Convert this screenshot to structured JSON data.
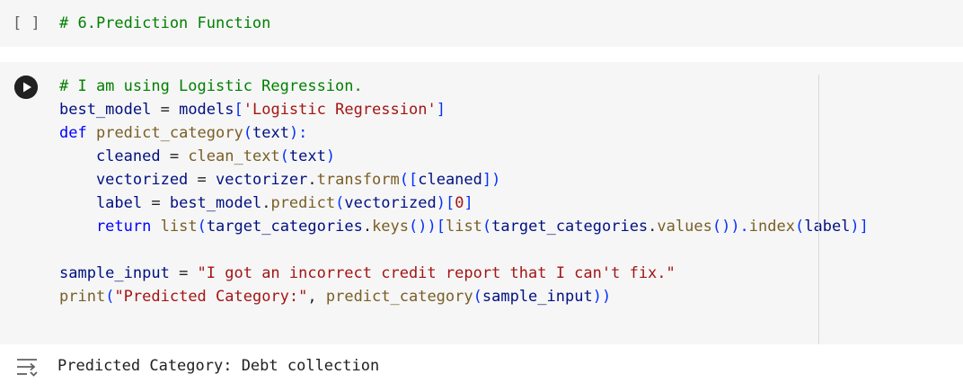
{
  "cells": [
    {
      "bracket": "[ ]",
      "lines": [
        [
          {
            "t": "# 6.Prediction Function",
            "c": "c"
          }
        ]
      ]
    },
    {
      "run_icon": "play-circle-icon",
      "lines": [
        [
          {
            "t": "# I am using Logistic Regression.",
            "c": "c"
          }
        ],
        [
          {
            "t": "best_model",
            "c": "v"
          },
          {
            "t": " = ",
            "c": ""
          },
          {
            "t": "models",
            "c": "v"
          },
          {
            "t": "[",
            "c": "b"
          },
          {
            "t": "'Logistic Regression'",
            "c": "s"
          },
          {
            "t": "]",
            "c": "b"
          }
        ],
        [
          {
            "t": "def",
            "c": "k"
          },
          {
            "t": " ",
            "c": ""
          },
          {
            "t": "predict_category",
            "c": "f"
          },
          {
            "t": "(",
            "c": "b"
          },
          {
            "t": "text",
            "c": "v"
          },
          {
            "t": "):",
            "c": "b"
          }
        ],
        [
          {
            "t": "    cleaned",
            "c": "v"
          },
          {
            "t": " = ",
            "c": ""
          },
          {
            "t": "clean_text",
            "c": "f"
          },
          {
            "t": "(",
            "c": "b"
          },
          {
            "t": "text",
            "c": "v"
          },
          {
            "t": ")",
            "c": "b"
          }
        ],
        [
          {
            "t": "    vectorized",
            "c": "v"
          },
          {
            "t": " = ",
            "c": ""
          },
          {
            "t": "vectorizer",
            "c": "v"
          },
          {
            "t": ".",
            "c": ""
          },
          {
            "t": "transform",
            "c": "f"
          },
          {
            "t": "([",
            "c": "b"
          },
          {
            "t": "cleaned",
            "c": "v"
          },
          {
            "t": "])",
            "c": "b"
          }
        ],
        [
          {
            "t": "    label",
            "c": "v"
          },
          {
            "t": " = ",
            "c": ""
          },
          {
            "t": "best_model",
            "c": "v"
          },
          {
            "t": ".",
            "c": ""
          },
          {
            "t": "predict",
            "c": "f"
          },
          {
            "t": "(",
            "c": "b"
          },
          {
            "t": "vectorized",
            "c": "v"
          },
          {
            "t": ")[",
            "c": "b"
          },
          {
            "t": "0",
            "c": "s"
          },
          {
            "t": "]",
            "c": "b"
          }
        ],
        [
          {
            "t": "    return",
            "c": "k"
          },
          {
            "t": " ",
            "c": ""
          },
          {
            "t": "list",
            "c": "f"
          },
          {
            "t": "(",
            "c": "b"
          },
          {
            "t": "target_categories",
            "c": "v"
          },
          {
            "t": ".",
            "c": ""
          },
          {
            "t": "keys",
            "c": "f"
          },
          {
            "t": "())[",
            "c": "b"
          },
          {
            "t": "list",
            "c": "f"
          },
          {
            "t": "(",
            "c": "b"
          },
          {
            "t": "target_categories",
            "c": "v"
          },
          {
            "t": ".",
            "c": ""
          },
          {
            "t": "values",
            "c": "f"
          },
          {
            "t": "()).",
            "c": "b"
          },
          {
            "t": "index",
            "c": "f"
          },
          {
            "t": "(",
            "c": "b"
          },
          {
            "t": "label",
            "c": "v"
          },
          {
            "t": ")]",
            "c": "b"
          }
        ],
        [
          {
            "t": "",
            "c": ""
          }
        ],
        [
          {
            "t": "sample_input",
            "c": "v"
          },
          {
            "t": " = ",
            "c": ""
          },
          {
            "t": "\"I got an incorrect credit report that I can't fix.\"",
            "c": "s"
          }
        ],
        [
          {
            "t": "print",
            "c": "f"
          },
          {
            "t": "(",
            "c": "b"
          },
          {
            "t": "\"Predicted Category:\"",
            "c": "s"
          },
          {
            "t": ", ",
            "c": ""
          },
          {
            "t": "predict_category",
            "c": "f"
          },
          {
            "t": "(",
            "c": "b"
          },
          {
            "t": "sample_input",
            "c": "v"
          },
          {
            "t": "))",
            "c": "b"
          }
        ]
      ]
    }
  ],
  "output": {
    "icon": "output-toggle-icon",
    "text": "Predicted Category: Debt collection"
  },
  "colors": {
    "cell_background": "#f6f6f6",
    "comment": "#008000",
    "keyword": "#0000ff",
    "string": "#a31515",
    "variable": "#001080",
    "function": "#795e26",
    "bracket": "#0431fa"
  }
}
